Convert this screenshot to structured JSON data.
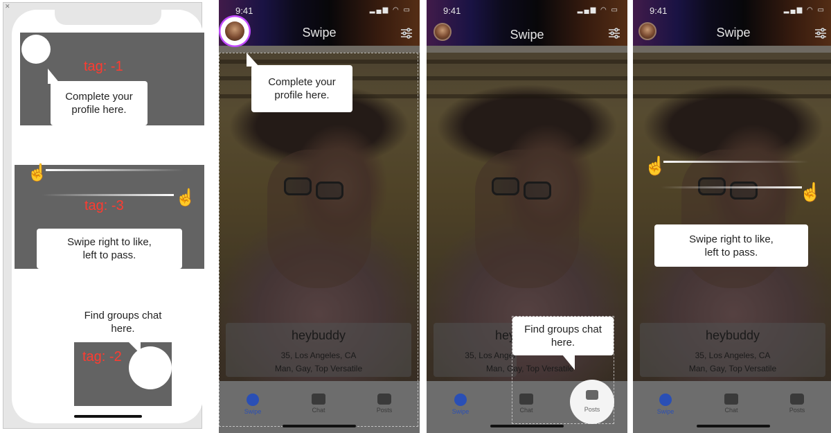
{
  "design": {
    "close_glyph": "✕",
    "tags": [
      "tag: -1",
      "tag: -3",
      "tag: -2"
    ],
    "bubbles": {
      "profile": "Complete your\nprofile here.",
      "swipe": "Swipe right to like,\nleft to pass.",
      "groups": "Find groups chat\nhere."
    }
  },
  "screens": {
    "status_time": "9:41",
    "status_icons": "▂▄▆ ◠ ▭",
    "title": "Swipe",
    "profile": {
      "name": "heybuddy",
      "location": "35, Los Angeles, CA",
      "details": "Man, Gay, Top Versatile",
      "name_partial": "hey",
      "location_partial": "35, Los Angel",
      "details_partial": "Man, Gay, Top Versatile"
    },
    "tabs": [
      {
        "label": "Swipe",
        "icon": "swipe-icon"
      },
      {
        "label": "Chat",
        "icon": "chat-icon"
      },
      {
        "label": "Posts",
        "icon": "posts-icon"
      }
    ],
    "coach_marks": {
      "profile": "Complete your\nprofile here.",
      "groups": "Find groups chat\nhere.",
      "swipe": "Swipe right to like,\nleft to pass."
    }
  },
  "colors": {
    "tag_red": "#ff3b30",
    "active_tab": "#2a4fb5",
    "avatar_ring": "#c548ff"
  }
}
